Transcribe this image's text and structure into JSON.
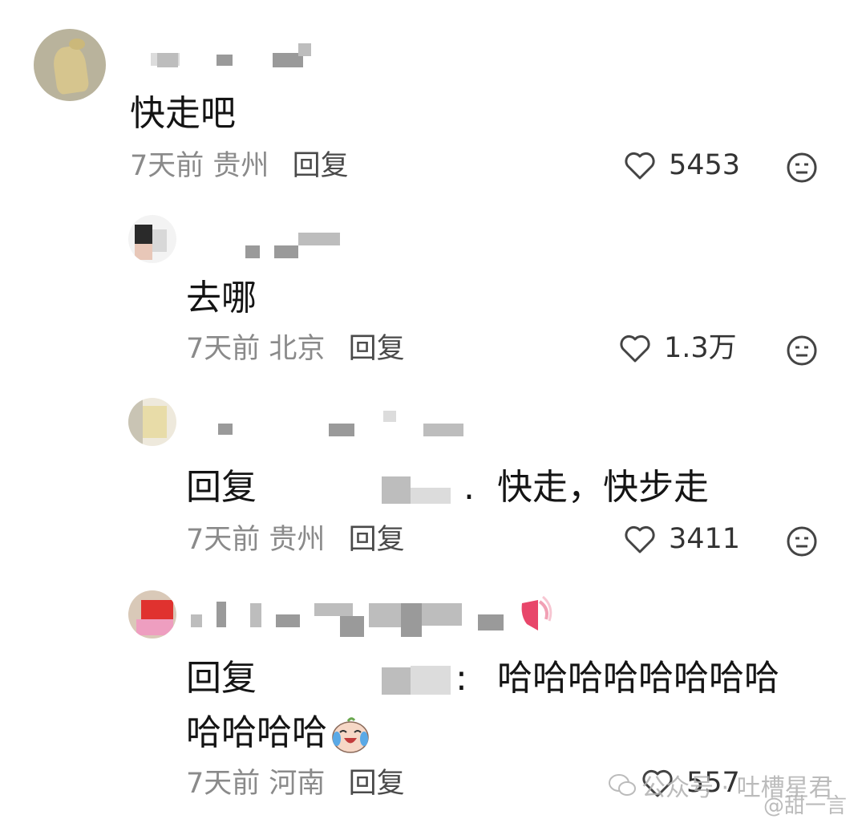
{
  "comments": [
    {
      "text": "快走吧",
      "time": "7天前",
      "location": "贵州",
      "reply_label": "回复",
      "likes": "5453"
    },
    {
      "text": "去哪",
      "time": "7天前",
      "location": "北京",
      "reply_label": "回复",
      "likes": "1.3万"
    },
    {
      "reply_prefix": "回复",
      "separator": ".",
      "text": "快走，快步走",
      "time": "7天前",
      "location": "贵州",
      "reply_label": "回复",
      "likes": "3411"
    },
    {
      "reply_prefix": "回复",
      "separator": ":",
      "text_line1": "哈哈哈哈哈哈哈哈",
      "text_line2": "哈哈哈哈",
      "time": "7天前",
      "location": "河南",
      "reply_label": "回复",
      "likes": "557"
    }
  ],
  "watermark": {
    "text": "公众号 · 吐槽星君",
    "handle": "@甜一言"
  },
  "colors": {
    "meta_gray": "#8a8a8a",
    "text_dark": "#141414",
    "heart_red": "#e8466a"
  },
  "icons": [
    "heart-outline-icon",
    "dislike-face-icon",
    "crying-laugh-emoji",
    "wechat-icon"
  ]
}
